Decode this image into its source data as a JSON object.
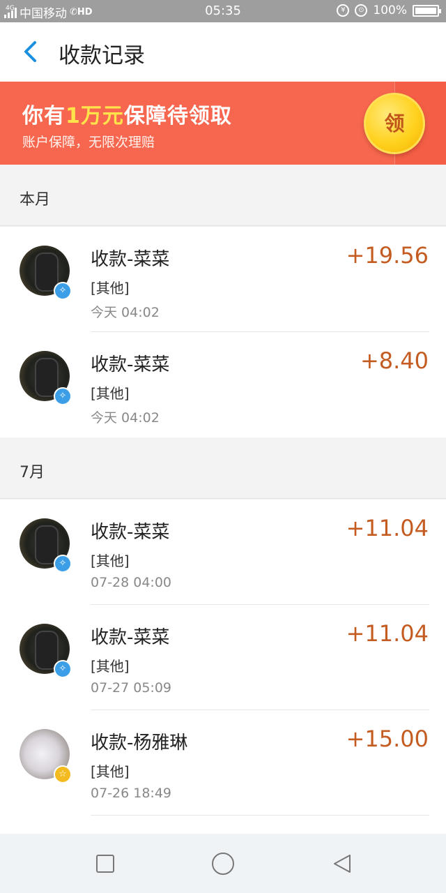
{
  "status_bar": {
    "network_tag": "4G",
    "carrier": "中国移动",
    "hd_label": "HD",
    "time": "05:35",
    "battery": "100%"
  },
  "header": {
    "title": "收款记录",
    "back_icon": "chevron-left-icon"
  },
  "banner": {
    "title_prefix": "你有",
    "title_highlight": "1万元",
    "title_suffix": "保障待领取",
    "subtitle": "账户保障，无限次理赔",
    "button_label": "领"
  },
  "sections": [
    {
      "label": "本月",
      "items": [
        {
          "title": "收款-菜菜",
          "category": "[其他]",
          "time": "今天  04:02",
          "amount": "+19.56",
          "badge": "blue"
        },
        {
          "title": "收款-菜菜",
          "category": "[其他]",
          "time": "今天  04:02",
          "amount": "+8.40",
          "badge": "blue"
        }
      ]
    },
    {
      "label": "7月",
      "items": [
        {
          "title": "收款-菜菜",
          "category": "[其他]",
          "time": "07-28  04:00",
          "amount": "+11.04",
          "badge": "blue"
        },
        {
          "title": "收款-菜菜",
          "category": "[其他]",
          "time": "07-27  05:09",
          "amount": "+11.04",
          "badge": "blue"
        },
        {
          "title": "收款-杨雅琳",
          "category": "[其他]",
          "time": "07-26  18:49",
          "amount": "+15.00",
          "badge": "gold"
        }
      ]
    }
  ],
  "colors": {
    "banner": "#f7674f",
    "amount": "#c45c22",
    "highlight": "#ffe34b",
    "back_icon": "#1a8fe0"
  },
  "system_nav": [
    "square-icon",
    "circle-icon",
    "triangle-back-icon"
  ]
}
